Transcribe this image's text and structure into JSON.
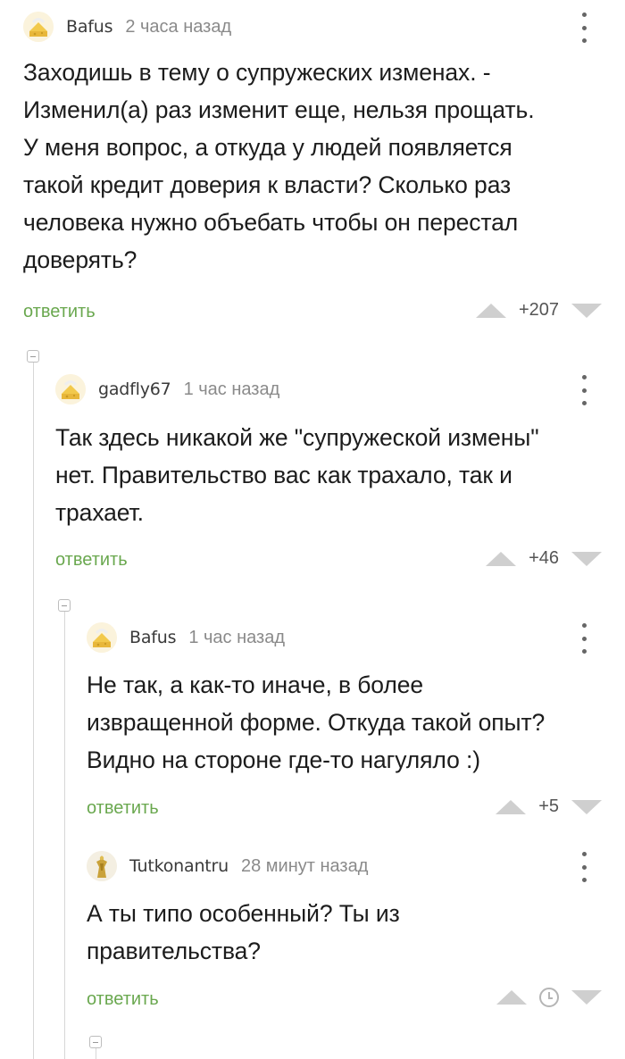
{
  "comments": [
    {
      "author": "Bafus",
      "time": "2 часа назад",
      "text_lines": [
        "Заходишь в тему о супружеских изменах. -",
        "Изменил(а) раз изменит еще, нельзя прощать.",
        "У меня вопрос, а откуда у людей появляется",
        "такой кредит доверия к власти? Сколько раз",
        "человека нужно объебать чтобы он перестал",
        "доверять?"
      ],
      "reply_label": "ответить",
      "rating": "+207",
      "avatar_icon": "cheese-avatar-icon"
    },
    {
      "author": "gadfly67",
      "time": "1 час назад",
      "text_lines": [
        "Так здесь никакой же \"супружеской измены\"",
        "нет. Правительство вас как трахало, так и",
        "трахает."
      ],
      "reply_label": "ответить",
      "rating": "+46",
      "avatar_icon": "cheese-avatar-icon"
    },
    {
      "author": "Bafus",
      "time": "1 час назад",
      "text_lines": [
        "Не так, а как-то иначе, в более",
        "извращенной форме. Откуда такой опыт?",
        "Видно на стороне где-то нагуляло :)"
      ],
      "reply_label": "ответить",
      "rating": "+5",
      "avatar_icon": "cheese-avatar-icon"
    },
    {
      "author": "Tutkonantru",
      "time": "28 минут назад",
      "text_lines": [
        "А ты типо особенный? Ты из",
        "правительства?"
      ],
      "reply_label": "ответить",
      "rating_hidden_icon": "clock-icon",
      "avatar_icon": "golden-figure-avatar-icon"
    }
  ],
  "colors": {
    "reply_link": "#6aa84f",
    "vote_arrow": "#cfcfcf",
    "meta_text": "#8a8a8a",
    "thread_line": "#d7d7d7"
  }
}
